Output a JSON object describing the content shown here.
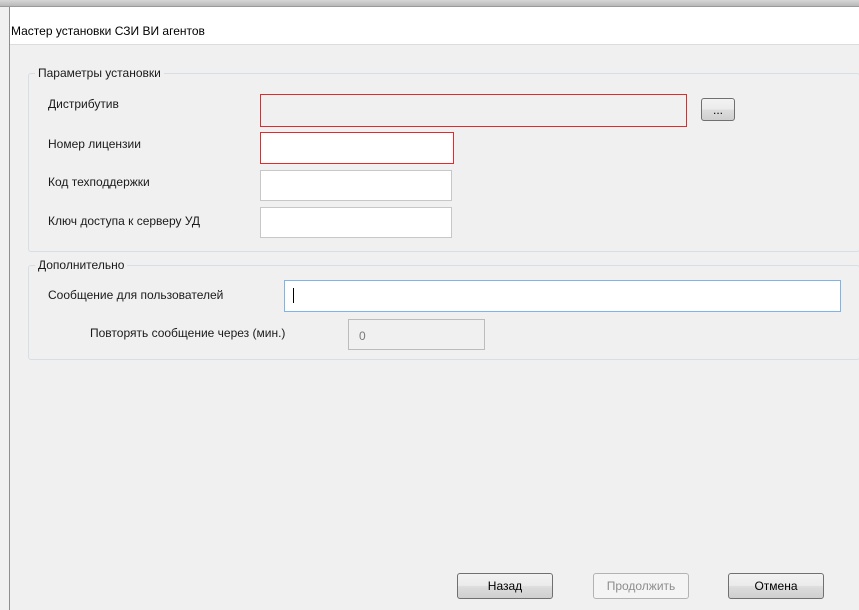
{
  "window": {
    "title": "Мастер установки СЗИ ВИ агентов"
  },
  "install_params": {
    "group_title": "Параметры установки",
    "distrib_label": "Дистрибутив",
    "distrib_value": "",
    "browse_label": "...",
    "license_label": "Номер лицензии",
    "license_value": "",
    "support_label": "Код техподдержки",
    "support_value": "",
    "server_key_label": "Ключ доступа к серверу УД",
    "server_key_value": ""
  },
  "additional": {
    "group_title": "Дополнительно",
    "message_label": "Сообщение для пользователей",
    "message_value": "",
    "repeat_label": "Повторять сообщение через (мин.)",
    "repeat_value": "0"
  },
  "buttons": {
    "back": "Назад",
    "continue": "Продолжить",
    "cancel": "Отмена"
  },
  "colors": {
    "error_border": "#e22a2a",
    "focus_border": "#7eb4ea",
    "background": "#f0f0f0"
  }
}
